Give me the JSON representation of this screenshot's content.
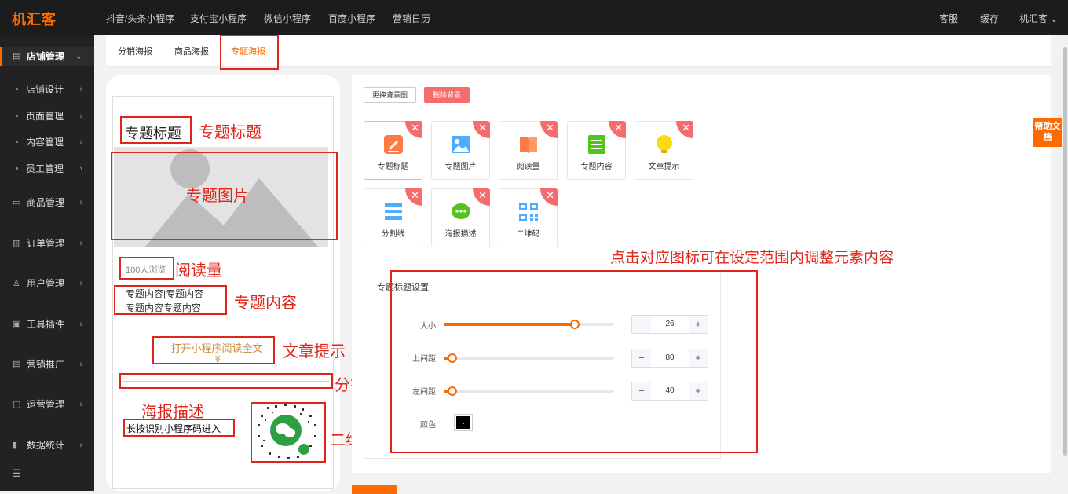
{
  "header": {
    "logo": "机汇客",
    "nav": [
      "抖音/头条小程序",
      "支付宝小程序",
      "微信小程序",
      "百度小程序",
      "营销日历"
    ],
    "right": [
      "客服",
      "缓存",
      "机汇客"
    ]
  },
  "sidebar": {
    "items": [
      {
        "label": "店铺管理",
        "icon": "shop-icon"
      },
      {
        "label": "店铺设计"
      },
      {
        "label": "页面管理"
      },
      {
        "label": "内容管理"
      },
      {
        "label": "员工管理"
      },
      {
        "label": "商品管理",
        "icon": "goods-icon"
      },
      {
        "label": "订单管理",
        "icon": "order-icon"
      },
      {
        "label": "用户管理",
        "icon": "user-icon"
      },
      {
        "label": "工具插件",
        "icon": "tool-icon"
      },
      {
        "label": "营销推广",
        "icon": "marketing-icon"
      },
      {
        "label": "运营管理",
        "icon": "operation-icon"
      },
      {
        "label": "数据统计",
        "icon": "stats-icon"
      }
    ],
    "collapse_icon": "menu-collapse-icon"
  },
  "tabs": [
    "分销海报",
    "商品海报",
    "专题海报"
  ],
  "preview": {
    "title": "专题标题",
    "title_annotation": "专题标题",
    "image_annotation": "专题图片",
    "read_count": "100人浏览",
    "read_annotation": "阅读量",
    "content_line1": "专题内容|专题内容",
    "content_line2": "专题内容专题内容",
    "content_annotation": "专题内容",
    "tip_text": "打开小程序阅读全文",
    "tip_chevron": "≫",
    "tip_annotation": "文章提示",
    "divider_annotation": "分割线",
    "desc_annotation": "海报描述",
    "desc_text": "长按识别小程序码进入",
    "qr_annotation": "二维码"
  },
  "toolbar": {
    "change_bg": "更换背景图",
    "delete_bg": "删除背景"
  },
  "components": [
    {
      "label": "专题标题",
      "icon": "edit-icon",
      "color": "#ff7a45"
    },
    {
      "label": "专题图片",
      "icon": "image-icon",
      "color": "#4facfe"
    },
    {
      "label": "阅读量",
      "icon": "book-icon",
      "color": "#ff7a45"
    },
    {
      "label": "专题内容",
      "icon": "list-icon",
      "color": "#52c41a"
    },
    {
      "label": "文章提示",
      "icon": "bulb-icon",
      "color": "#fadb14"
    },
    {
      "label": "分割线",
      "icon": "divider-icon",
      "color": "#4facfe"
    },
    {
      "label": "海报描述",
      "icon": "chat-icon",
      "color": "#52c41a"
    },
    {
      "label": "二维码",
      "icon": "qrcode-icon",
      "color": "#4facfe"
    }
  ],
  "remove_glyph": "✕",
  "hint": "点击对应图标可在设定范围内调整元素内容",
  "settings": {
    "title": "专题标题设置",
    "rows": [
      {
        "label": "大小",
        "value": "26",
        "level": 0.77
      },
      {
        "label": "上间距",
        "value": "80",
        "level": 0.05
      },
      {
        "label": "左间距",
        "value": "40",
        "level": 0.05
      }
    ],
    "minus": "−",
    "plus": "+",
    "color_label": "颜色",
    "color_value": "#000000",
    "color_caret": "⌄"
  },
  "help": "帮助文档",
  "accent": "#ff6a00",
  "annotation_color": "#e0251b"
}
